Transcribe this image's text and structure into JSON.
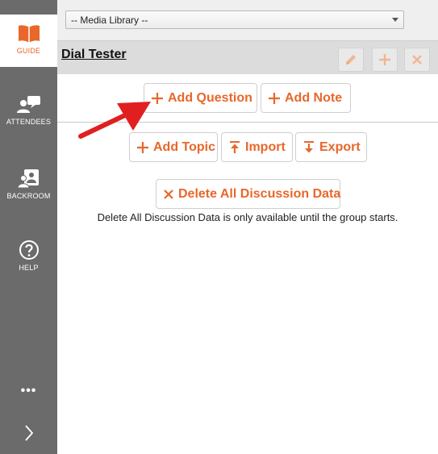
{
  "sidebar": {
    "items": [
      {
        "label": "GUIDE",
        "icon": "book-icon",
        "active": true
      },
      {
        "label": "ATTENDEES",
        "icon": "people-chat-icon"
      },
      {
        "label": "BACKROOM",
        "icon": "backroom-person-icon"
      },
      {
        "label": "HELP",
        "icon": "help-icon"
      }
    ],
    "more_label": "•••",
    "expand_icon": "chevron-right-icon"
  },
  "header": {
    "media_select_value": "-- Media Library --"
  },
  "guide": {
    "title": "Dial Tester",
    "toolbar": {
      "edit_icon": "pencil-icon",
      "add_icon": "plus-icon",
      "close_icon": "close-icon"
    },
    "buttons": {
      "add_question": "Add Question",
      "add_note": "Add Note",
      "add_topic": "Add Topic",
      "import": "Import",
      "export": "Export",
      "delete_all": "Delete All Discussion Data"
    },
    "delete_note": "Delete All Discussion Data is only available until the group starts."
  },
  "colors": {
    "accent": "#e8672a",
    "sidebar": "#6b6b6b",
    "arrow": "#e02020"
  }
}
